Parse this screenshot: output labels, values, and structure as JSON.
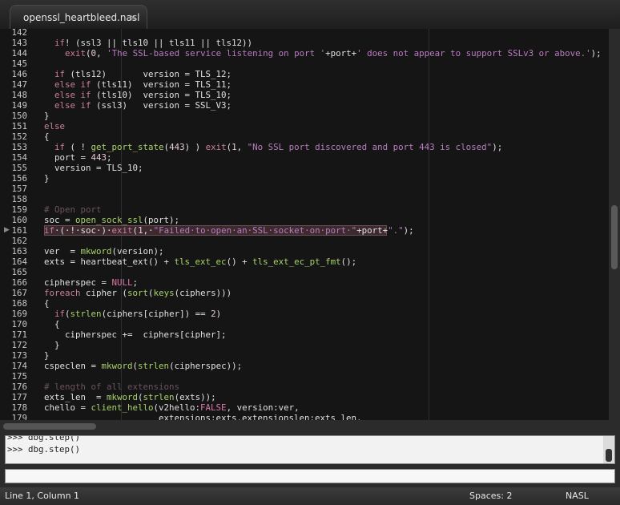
{
  "tab": {
    "title": "openssl_heartbleed.nasl",
    "close_icon": "×"
  },
  "editor": {
    "lines": [
      {
        "n": "142",
        "segs": [
          {
            "t": "",
            "c": ""
          }
        ]
      },
      {
        "n": "143",
        "segs": [
          {
            "t": "  if",
            "c": "kw"
          },
          {
            "t": "! (ssl3 || tls10 || tls11 || tls12))",
            "c": ""
          }
        ]
      },
      {
        "n": "144",
        "segs": [
          {
            "t": "    ",
            "c": ""
          },
          {
            "t": "exit",
            "c": "kw"
          },
          {
            "t": "(",
            "c": ""
          },
          {
            "t": "0",
            "c": "num"
          },
          {
            "t": ", ",
            "c": ""
          },
          {
            "t": "'The SSL-based service listening on port '",
            "c": "str"
          },
          {
            "t": "+port+",
            "c": ""
          },
          {
            "t": "' does not appear to support SSLv3 or above.'",
            "c": "str"
          },
          {
            "t": ");",
            "c": ""
          }
        ]
      },
      {
        "n": "145",
        "segs": [
          {
            "t": "",
            "c": ""
          }
        ]
      },
      {
        "n": "146",
        "segs": [
          {
            "t": "  ",
            "c": ""
          },
          {
            "t": "if",
            "c": "kw"
          },
          {
            "t": " (tls12)       version = TLS_12;",
            "c": ""
          }
        ]
      },
      {
        "n": "147",
        "segs": [
          {
            "t": "  ",
            "c": ""
          },
          {
            "t": "else if",
            "c": "kw"
          },
          {
            "t": " (tls11)  version = TLS_11;",
            "c": ""
          }
        ]
      },
      {
        "n": "148",
        "segs": [
          {
            "t": "  ",
            "c": ""
          },
          {
            "t": "else if",
            "c": "kw"
          },
          {
            "t": " (tls10)  version = TLS_10;",
            "c": ""
          }
        ]
      },
      {
        "n": "149",
        "segs": [
          {
            "t": "  ",
            "c": ""
          },
          {
            "t": "else if",
            "c": "kw"
          },
          {
            "t": " (ssl3)   version = SSL_V3;",
            "c": ""
          }
        ]
      },
      {
        "n": "150",
        "segs": [
          {
            "t": "}",
            "c": ""
          }
        ]
      },
      {
        "n": "151",
        "segs": [
          {
            "t": "else",
            "c": "kw"
          }
        ]
      },
      {
        "n": "152",
        "segs": [
          {
            "t": "{",
            "c": ""
          }
        ]
      },
      {
        "n": "153",
        "segs": [
          {
            "t": "  ",
            "c": ""
          },
          {
            "t": "if",
            "c": "kw"
          },
          {
            "t": " ( ! ",
            "c": ""
          },
          {
            "t": "get_port_state",
            "c": "fn"
          },
          {
            "t": "(",
            "c": ""
          },
          {
            "t": "443",
            "c": "num"
          },
          {
            "t": ") ) ",
            "c": ""
          },
          {
            "t": "exit",
            "c": "kw"
          },
          {
            "t": "(",
            "c": ""
          },
          {
            "t": "1",
            "c": "num"
          },
          {
            "t": ", ",
            "c": ""
          },
          {
            "t": "\"No SSL port discovered and port 443 is closed\"",
            "c": "str"
          },
          {
            "t": ");",
            "c": ""
          }
        ]
      },
      {
        "n": "154",
        "segs": [
          {
            "t": "  port = ",
            "c": ""
          },
          {
            "t": "443",
            "c": "num"
          },
          {
            "t": ";",
            "c": ""
          }
        ]
      },
      {
        "n": "155",
        "segs": [
          {
            "t": "  version = TLS_10;",
            "c": ""
          }
        ]
      },
      {
        "n": "156",
        "segs": [
          {
            "t": "}",
            "c": ""
          }
        ]
      },
      {
        "n": "157",
        "segs": [
          {
            "t": "",
            "c": ""
          }
        ]
      },
      {
        "n": "158",
        "segs": [
          {
            "t": "",
            "c": ""
          }
        ]
      },
      {
        "n": "159",
        "segs": [
          {
            "t": "# Open port",
            "c": "cmt"
          }
        ]
      },
      {
        "n": "160",
        "segs": [
          {
            "t": "soc = ",
            "c": ""
          },
          {
            "t": "open_sock_ssl",
            "c": "fn"
          },
          {
            "t": "(port);",
            "c": ""
          }
        ]
      },
      {
        "n": "161",
        "hl": true,
        "segs": [
          {
            "t": "if",
            "c": "kw"
          },
          {
            "t": "·(·!·soc·)·",
            "c": ""
          },
          {
            "t": "exit",
            "c": "kw"
          },
          {
            "t": "(",
            "c": ""
          },
          {
            "t": "1",
            "c": "num"
          },
          {
            "t": ",·",
            "c": ""
          },
          {
            "t": "\"Failed·to·open·an·SSL·socket·on·port·\"",
            "c": "str"
          },
          {
            "t": "+port+",
            "c": ""
          },
          {
            "t": "\".\"",
            "c": "str"
          },
          {
            "t": ");",
            "c": ""
          }
        ]
      },
      {
        "n": "162",
        "segs": [
          {
            "t": "",
            "c": ""
          }
        ]
      },
      {
        "n": "163",
        "segs": [
          {
            "t": "ver  = ",
            "c": ""
          },
          {
            "t": "mkword",
            "c": "fn"
          },
          {
            "t": "(version);",
            "c": ""
          }
        ]
      },
      {
        "n": "164",
        "segs": [
          {
            "t": "exts = ",
            "c": ""
          },
          {
            "t": "heartbeat_ext",
            "c": ""
          },
          {
            "t": "() + ",
            "c": ""
          },
          {
            "t": "tls_ext_ec",
            "c": "fn"
          },
          {
            "t": "() + ",
            "c": ""
          },
          {
            "t": "tls_ext_ec_pt_fmt",
            "c": "fn"
          },
          {
            "t": "();",
            "c": ""
          }
        ]
      },
      {
        "n": "165",
        "segs": [
          {
            "t": "",
            "c": ""
          }
        ]
      },
      {
        "n": "166",
        "segs": [
          {
            "t": "cipherspec = ",
            "c": ""
          },
          {
            "t": "NULL",
            "c": "cst"
          },
          {
            "t": ";",
            "c": ""
          }
        ]
      },
      {
        "n": "167",
        "segs": [
          {
            "t": "foreach",
            "c": "kw"
          },
          {
            "t": " cipher (",
            "c": ""
          },
          {
            "t": "sort",
            "c": "fn"
          },
          {
            "t": "(",
            "c": ""
          },
          {
            "t": "keys",
            "c": "fn"
          },
          {
            "t": "(ciphers)))",
            "c": ""
          }
        ]
      },
      {
        "n": "168",
        "segs": [
          {
            "t": "{",
            "c": ""
          }
        ]
      },
      {
        "n": "169",
        "segs": [
          {
            "t": "  ",
            "c": ""
          },
          {
            "t": "if",
            "c": "kw"
          },
          {
            "t": "(",
            "c": ""
          },
          {
            "t": "strlen",
            "c": "fn"
          },
          {
            "t": "(ciphers[cipher]) == ",
            "c": ""
          },
          {
            "t": "2",
            "c": "num"
          },
          {
            "t": ")",
            "c": ""
          }
        ]
      },
      {
        "n": "170",
        "segs": [
          {
            "t": "  {",
            "c": ""
          }
        ]
      },
      {
        "n": "171",
        "segs": [
          {
            "t": "    cipherspec +=  ciphers[cipher];",
            "c": ""
          }
        ]
      },
      {
        "n": "172",
        "segs": [
          {
            "t": "  }",
            "c": ""
          }
        ]
      },
      {
        "n": "173",
        "segs": [
          {
            "t": "}",
            "c": ""
          }
        ]
      },
      {
        "n": "174",
        "segs": [
          {
            "t": "cspeclen = ",
            "c": ""
          },
          {
            "t": "mkword",
            "c": "fn"
          },
          {
            "t": "(",
            "c": ""
          },
          {
            "t": "strlen",
            "c": "fn"
          },
          {
            "t": "(cipherspec));",
            "c": ""
          }
        ]
      },
      {
        "n": "175",
        "segs": [
          {
            "t": "",
            "c": ""
          }
        ]
      },
      {
        "n": "176",
        "segs": [
          {
            "t": "# length of all extensions",
            "c": "cmt"
          }
        ]
      },
      {
        "n": "177",
        "segs": [
          {
            "t": "exts_len  = ",
            "c": ""
          },
          {
            "t": "mkword",
            "c": "fn"
          },
          {
            "t": "(",
            "c": ""
          },
          {
            "t": "strlen",
            "c": "fn"
          },
          {
            "t": "(exts));",
            "c": ""
          }
        ]
      },
      {
        "n": "178",
        "segs": [
          {
            "t": "chello = ",
            "c": ""
          },
          {
            "t": "client_hello",
            "c": "fn"
          },
          {
            "t": "(v2hello:",
            "c": ""
          },
          {
            "t": "FALSE",
            "c": "cst"
          },
          {
            "t": ", version:ver,",
            "c": ""
          }
        ]
      },
      {
        "n": "179",
        "segs": [
          {
            "t": "                      extensions:exts,extensionslen:exts_len,",
            "c": ""
          }
        ]
      }
    ]
  },
  "console": {
    "lines": [
      ">>> dbg.step()",
      ">>> dbg.step()"
    ]
  },
  "status": {
    "position": "Line 1, Column 1",
    "spaces": "Spaces: 2",
    "syntax": "NASL"
  }
}
